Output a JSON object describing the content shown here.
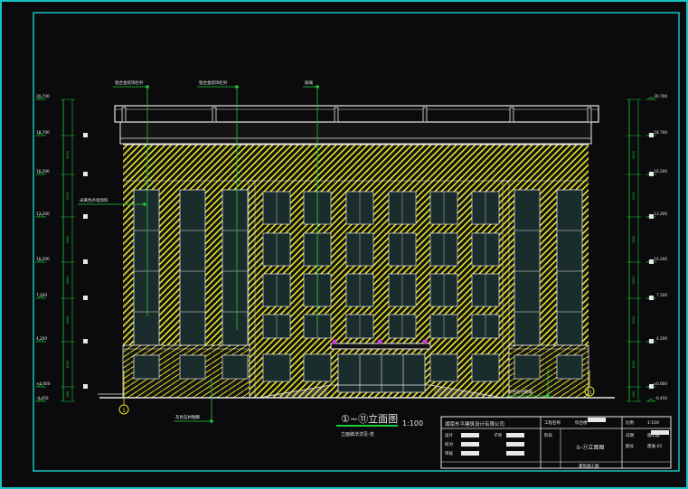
{
  "drawing": {
    "title_main": "①~⑪立面图",
    "scale": "1:100",
    "subtitle": "立面做法详见-览",
    "grid_left": "1",
    "grid_right": "11"
  },
  "levels_left": [
    {
      "label": "20.700",
      "dim": ""
    },
    {
      "label": "18.700",
      "dim": ""
    },
    {
      "label": "16.200",
      "dim": "3000"
    },
    {
      "label": "13.200",
      "dim": "3000"
    },
    {
      "label": "10.200",
      "dim": "3000"
    },
    {
      "label": "7.200",
      "dim": "3000"
    },
    {
      "label": "4.200",
      "dim": "3000"
    },
    {
      "label": "±0.000",
      "dim": "4200"
    },
    {
      "label": "-0.450",
      "dim": "450"
    }
  ],
  "levels_right": [
    {
      "label": "20.700",
      "dim": ""
    },
    {
      "label": "18.700",
      "dim": ""
    },
    {
      "label": "16.200",
      "dim": "3000"
    },
    {
      "label": "13.200",
      "dim": "3000"
    },
    {
      "label": "10.200",
      "dim": "3000"
    },
    {
      "label": "7.200",
      "dim": "3000"
    },
    {
      "label": "4.200",
      "dim": "3000"
    },
    {
      "label": "±0.000",
      "dim": "4200"
    },
    {
      "label": "-0.450",
      "dim": "450"
    }
  ],
  "callouts": {
    "top1": "铝合金装饰栏杆",
    "top2": "铝合金装饰栏杆",
    "top3": "玻璃",
    "side": "米黄色外墙涂料",
    "bottom_left": "灰色石材勒脚",
    "bottom_right": "灰色石材勒脚"
  },
  "title_block": {
    "company": "湖南东平建筑设计有限公司",
    "project": "综合楼",
    "drawing_name": "①-⑪立面图",
    "label_project": "工程名称",
    "label_sub": "子项",
    "label_design": "设计",
    "label_check": "校对",
    "label_approve": "审核",
    "label_scale": "比例",
    "scale_val": "1:100",
    "label_date": "日期",
    "label_sheet": "图号",
    "sheet_val": "建施-05",
    "label_stage": "阶段",
    "stage_val": "施工图",
    "footer": "建筑施工图"
  },
  "colors": {
    "frame": "#18c2c2",
    "line": "#e8e8e8",
    "wall": "#e6e62a",
    "dim": "#1ecb3a",
    "window": "#1b2c2c",
    "accent": "#d73ad7"
  }
}
